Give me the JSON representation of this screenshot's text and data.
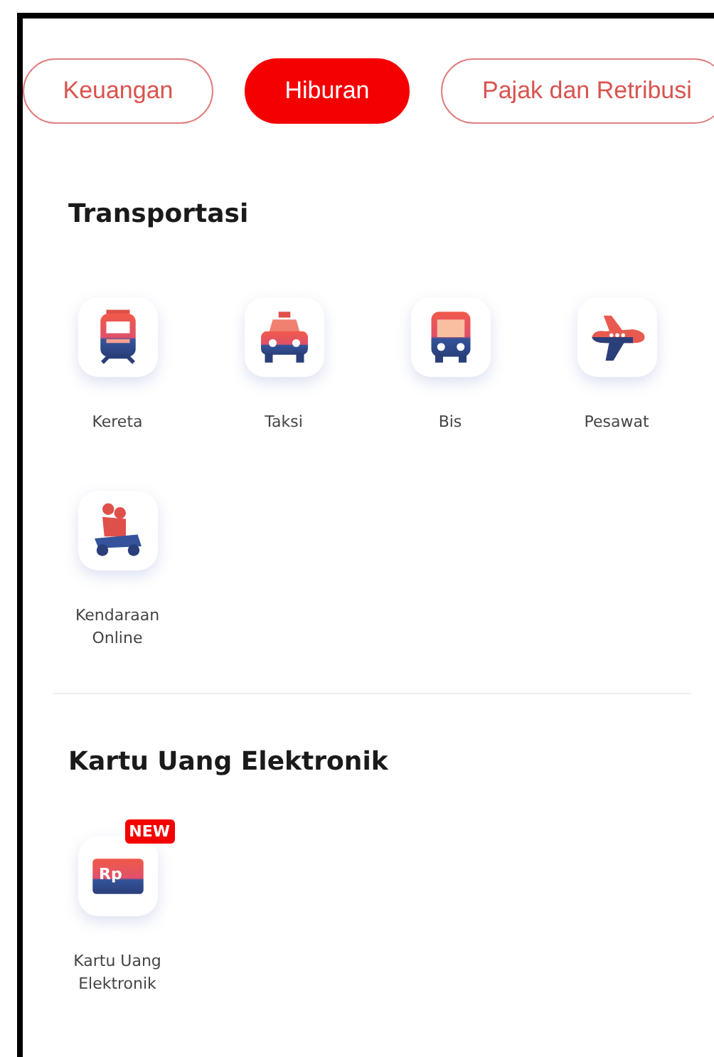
{
  "tabs": [
    {
      "label": "Keuangan",
      "selected": false
    },
    {
      "label": "Hiburan",
      "selected": true
    },
    {
      "label": "Pajak dan Retribusi",
      "selected": false
    }
  ],
  "sections": [
    {
      "title": "Transportasi",
      "items": [
        {
          "label": "Kereta"
        },
        {
          "label": "Taksi"
        },
        {
          "label": "Bis"
        },
        {
          "label": "Pesawat"
        },
        {
          "label": "Kendaraan Online"
        }
      ]
    },
    {
      "title": "Kartu Uang Elektronik",
      "items": [
        {
          "label": "Kartu Uang Elektronik",
          "icon_text": "Rp",
          "badge": "NEW"
        }
      ]
    }
  ]
}
